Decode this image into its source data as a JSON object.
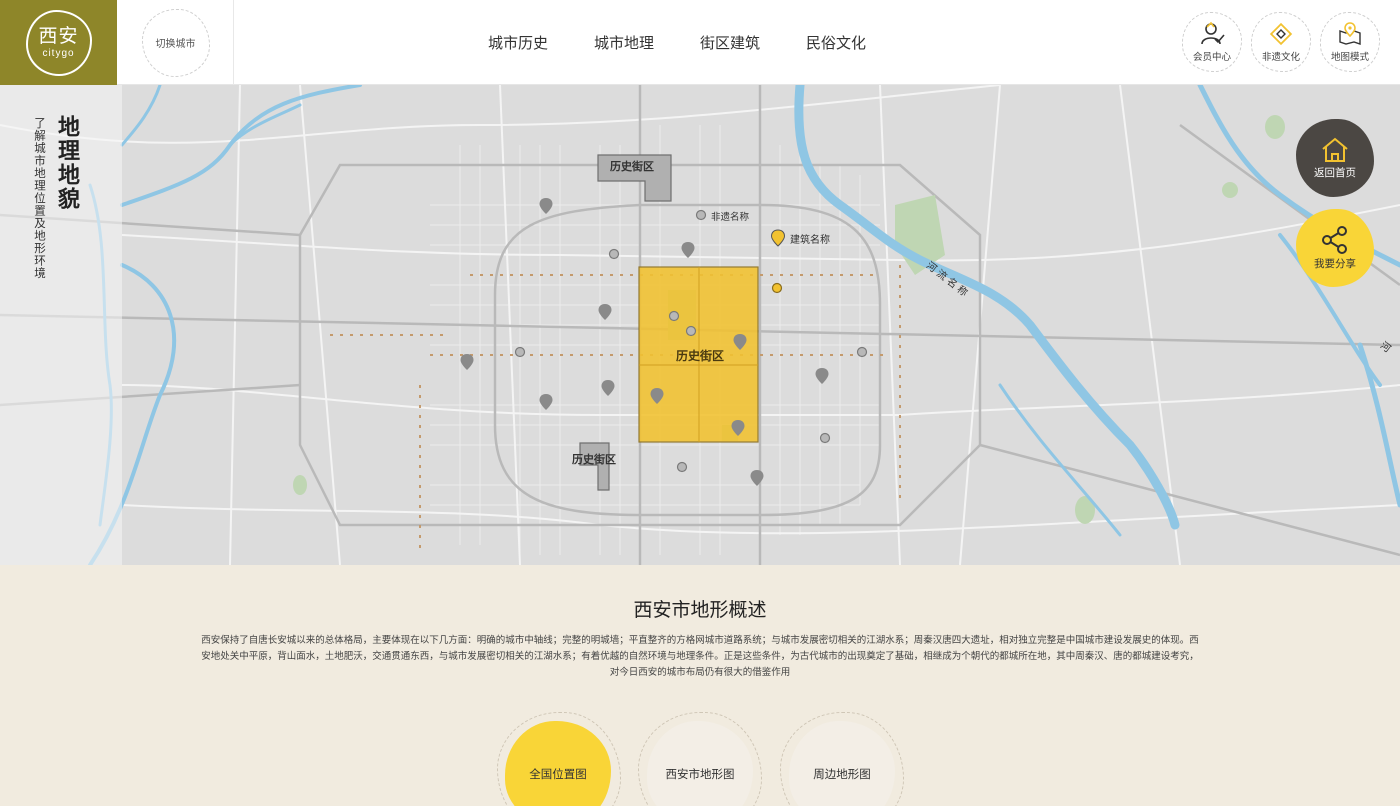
{
  "header": {
    "logo": {
      "cn": "西安",
      "en": "citygo"
    },
    "city_switch": "切换城市",
    "nav": [
      "城市历史",
      "城市地理",
      "街区建筑",
      "民俗文化"
    ],
    "tools": [
      {
        "label": "会员中心",
        "icon": "member-icon"
      },
      {
        "label": "非遗文化",
        "icon": "heritage-icon"
      },
      {
        "label": "地图模式",
        "icon": "map-mode-icon"
      }
    ]
  },
  "map": {
    "side_title": "地理地貌",
    "side_subtitle": "了解城市地理位置及地形环境",
    "districts": [
      "历史街区",
      "历史街区",
      "历史街区"
    ],
    "poi_labels": {
      "heritage": "非遗名称",
      "building": "建筑名称"
    },
    "river_label": "河流名称",
    "river_label_edge": "河",
    "buttons": {
      "home": "返回首页",
      "share": "我要分享"
    },
    "colors": {
      "highlight": "#f2c230",
      "river": "#8fc6e4",
      "button_dark": "#4b4743",
      "button_yellow": "#f9d537"
    }
  },
  "overview": {
    "title": "西安市地形概述",
    "text": "西安保持了自唐长安城以来的总体格局，主要体现在以下几方面：明确的城市中轴线；完整的明城墙；平直整齐的方格网城市道路系统；与城市发展密切相关的江湖水系；周秦汉唐四大遗址，相对独立完整是中国城市建设发展史的体现。西安地处关中平原，背山面水，土地肥沃，交通贯通东西，与城市发展密切相关的江湖水系；有着优越的自然环境与地理条件。正是这些条件，为古代城市的出现奠定了基础，相继成为个朝代的都城所在地，其中周秦汉、唐的都城建设考究，对今日西安的城市布局仍有很大的借鉴作用",
    "tabs": [
      {
        "label": "全国位置图",
        "active": true
      },
      {
        "label": "西安市地形图",
        "active": false
      },
      {
        "label": "周边地形图",
        "active": false
      }
    ]
  }
}
